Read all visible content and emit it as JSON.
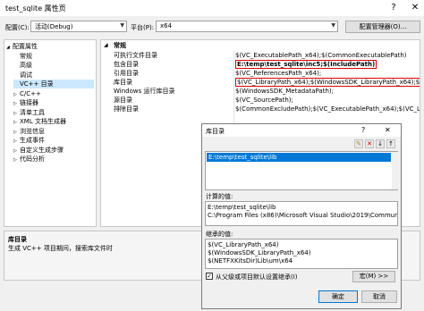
{
  "window": {
    "title": "test_sqlite 属性页",
    "help": "?",
    "close": "✕"
  },
  "config": {
    "config_label": "配置(C):",
    "config_value": "活动(Debug)",
    "platform_label": "平台(P):",
    "platform_value": "x64",
    "config_manager": "配置管理器(O)..."
  },
  "tree": {
    "items": [
      {
        "label": "配置属性",
        "prefix": "◢"
      },
      {
        "label": "常规",
        "prefix": ""
      },
      {
        "label": "高级",
        "prefix": ""
      },
      {
        "label": "调试",
        "prefix": ""
      },
      {
        "label": "VC++ 目录",
        "prefix": ""
      },
      {
        "label": "C/C++",
        "prefix": "▷"
      },
      {
        "label": "链接器",
        "prefix": "▷"
      },
      {
        "label": "清单工具",
        "prefix": "▷"
      },
      {
        "label": "XML 文档生成器",
        "prefix": "▷"
      },
      {
        "label": "浏览信息",
        "prefix": "▷"
      },
      {
        "label": "生成事件",
        "prefix": "▷"
      },
      {
        "label": "自定义生成步骤",
        "prefix": "▷"
      },
      {
        "label": "代码分析",
        "prefix": "▷"
      }
    ]
  },
  "grid": {
    "section": "常规",
    "section_toggle": "◢",
    "rows": [
      {
        "key": "可执行文件目录",
        "value": "$(VC_ExecutablePath_x64);$(CommonExecutablePath)"
      },
      {
        "key": "包含目录",
        "value": "E:\\temp\\test_sqlite\\inc5;$(IncludePath)"
      },
      {
        "key": "引用目录",
        "value": "$(VC_ReferencesPath_x64);"
      },
      {
        "key": "库目录",
        "value": "$(VC_LibraryPath_x64);$(WindowsSDK_LibraryPath_x64);$(NETFX"
      },
      {
        "key": "Windows 运行库目录",
        "value": "$(WindowsSDK_MetadataPath);"
      },
      {
        "key": "源目录",
        "value": "$(VC_SourcePath);"
      },
      {
        "key": "排除目录",
        "value": "$(CommonExcludePath);$(VC_ExecutablePath_x64);$(VC_LibraryPa"
      }
    ]
  },
  "description": {
    "title": "库目录",
    "text": "生成 VC++ 项目期间，搜索库文件时"
  },
  "dialog": {
    "title": "库目录",
    "help": "?",
    "close": "✕",
    "entry": "E:\\temp\\test_sqlite\\lib",
    "evaluated_label": "计算的值:",
    "evaluated": [
      "E:\\temp\\test_sqlite\\lib",
      "C:\\Program Files (x86)\\Microsoft Visual Studio\\2019\\Community\\"
    ],
    "inherited_label": "继承的值:",
    "inherited": [
      "$(VC_LibraryPath_x64)",
      "$(WindowsSDK_LibraryPath_x64)",
      "$(NETFXKitsDir)Lib\\um\\x64"
    ],
    "inherit_checkbox": "从父级或项目默认设置继承(I)",
    "macro_button": "宏(M) >>",
    "ok": "确定",
    "cancel": "取消"
  }
}
